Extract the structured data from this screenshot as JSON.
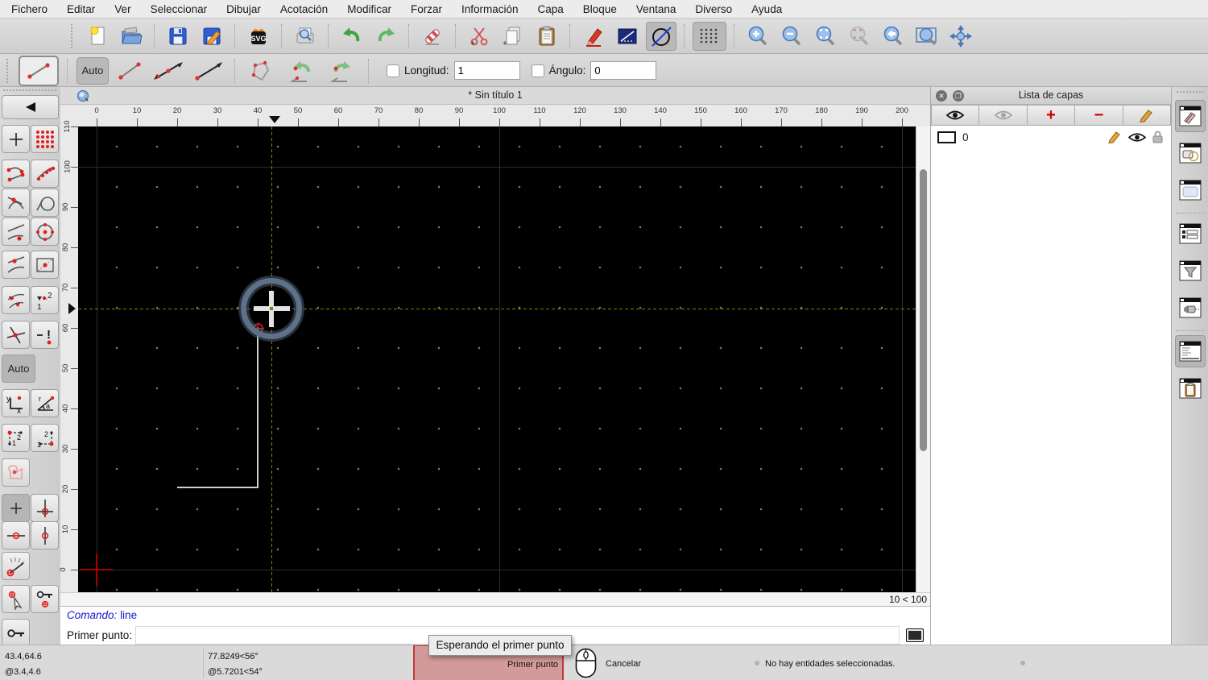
{
  "menu": {
    "items": [
      {
        "label": "Fichero"
      },
      {
        "label": "Editar"
      },
      {
        "label": "Ver"
      },
      {
        "label": "Seleccionar"
      },
      {
        "label": "Dibujar"
      },
      {
        "label": "Acotación"
      },
      {
        "label": "Modificar"
      },
      {
        "label": "Forzar"
      },
      {
        "label": "Información"
      },
      {
        "label": "Capa"
      },
      {
        "label": "Bloque"
      },
      {
        "label": "Ventana"
      },
      {
        "label": "Diverso"
      },
      {
        "label": "Ayuda"
      }
    ]
  },
  "toolbar": {
    "buttons": [
      "new-file",
      "open-file",
      "save",
      "save-as",
      "export-svg",
      "print-preview",
      "undo",
      "redo",
      "erase",
      "cut",
      "copy",
      "paste",
      "pen-edit",
      "attributes",
      "draft-circle",
      "grid-toggle",
      "zoom-in",
      "zoom-out",
      "zoom-auto",
      "zoom-previous",
      "zoom-back",
      "zoom-window",
      "zoom-pan"
    ]
  },
  "options": {
    "tool": "line-two-points",
    "auto_label": "Auto",
    "length_label": "Longitud:",
    "length_value": "1",
    "angle_label": "Ángulo:",
    "angle_value": "0"
  },
  "snapbar": {
    "auto_label": "Auto",
    "buttons": [
      "back",
      "snap-free",
      "snap-grid",
      "snap-endpoints",
      "snap-on-entity",
      "snap-intersection",
      "snap-circle",
      "snap-nearest",
      "snap-center",
      "snap-tangent",
      "snap-middle",
      "snap-auto",
      "snap-points",
      "snap-intersection-manual",
      "snap-exclusive",
      "coordinate-cartesian",
      "coordinate-polar",
      "relative-point-1",
      "relative-point-2",
      "select-entity",
      "restrict-nothing",
      "restrict-orthogonal",
      "restrict-horizontal",
      "restrict-vertical",
      "angle-gauge",
      "set-relative-zero",
      "lock-relative-zero",
      "lock"
    ]
  },
  "tab": {
    "title": "* Sin título 1"
  },
  "rulers": {
    "h": [
      "0",
      "10",
      "20",
      "30",
      "40",
      "50",
      "60",
      "70",
      "80",
      "90",
      "100",
      "110",
      "120",
      "130",
      "140",
      "150",
      "160",
      "170",
      "180",
      "190",
      "200"
    ],
    "v": [
      "0",
      "10",
      "20",
      "30",
      "40",
      "50",
      "60",
      "70",
      "80",
      "90",
      "100",
      "110"
    ]
  },
  "canvas": {
    "grid_status": "10 < 100"
  },
  "command": {
    "history_label": "Comando:",
    "history_value": "line",
    "prompt_label": "Primer punto:",
    "input_value": ""
  },
  "statusbar": {
    "abs_coord": "43.4,64.6",
    "rel_coord": "@3.4,4.6",
    "abs_polar": "77.8249<56°",
    "rel_polar": "@5.7201<54°",
    "mouse_left_hint": "Primer punto",
    "mouse_right_hint": "Cancelar",
    "tooltip": "Esperando el primer punto",
    "selection_status": "No hay entidades seleccionadas."
  },
  "layers_panel": {
    "title": "Lista de capas",
    "toolbar": [
      "show-all-layers",
      "hide-all-layers",
      "add-layer",
      "remove-layer",
      "edit-layer"
    ],
    "layers": [
      {
        "name": "0"
      }
    ],
    "close_glyph": "✕",
    "float_glyph": "❐",
    "add_glyph": "+",
    "remove_glyph": "−"
  },
  "widgetstrip": {
    "buttons": [
      "layer-list-widget",
      "block-list-widget",
      "library-widget",
      "entity-layer-widget",
      "filter-widget",
      "command-audio-widget",
      "command-line-widget",
      "clipboard-widget"
    ]
  },
  "icons": {
    "glyphs": {
      "svg": "SVG",
      "y": "y",
      "x": "x",
      "r": "r",
      "a": "a",
      "one": "1",
      "two": "2",
      "excl": "!"
    }
  },
  "colors": {
    "accent_blue": "#2f5fd0",
    "snap_red": "#d00000",
    "crosshair": "#937c08",
    "canvas_bg": "#000000",
    "hint_red": "#c03a3a",
    "command_blue": "#1616cf"
  }
}
